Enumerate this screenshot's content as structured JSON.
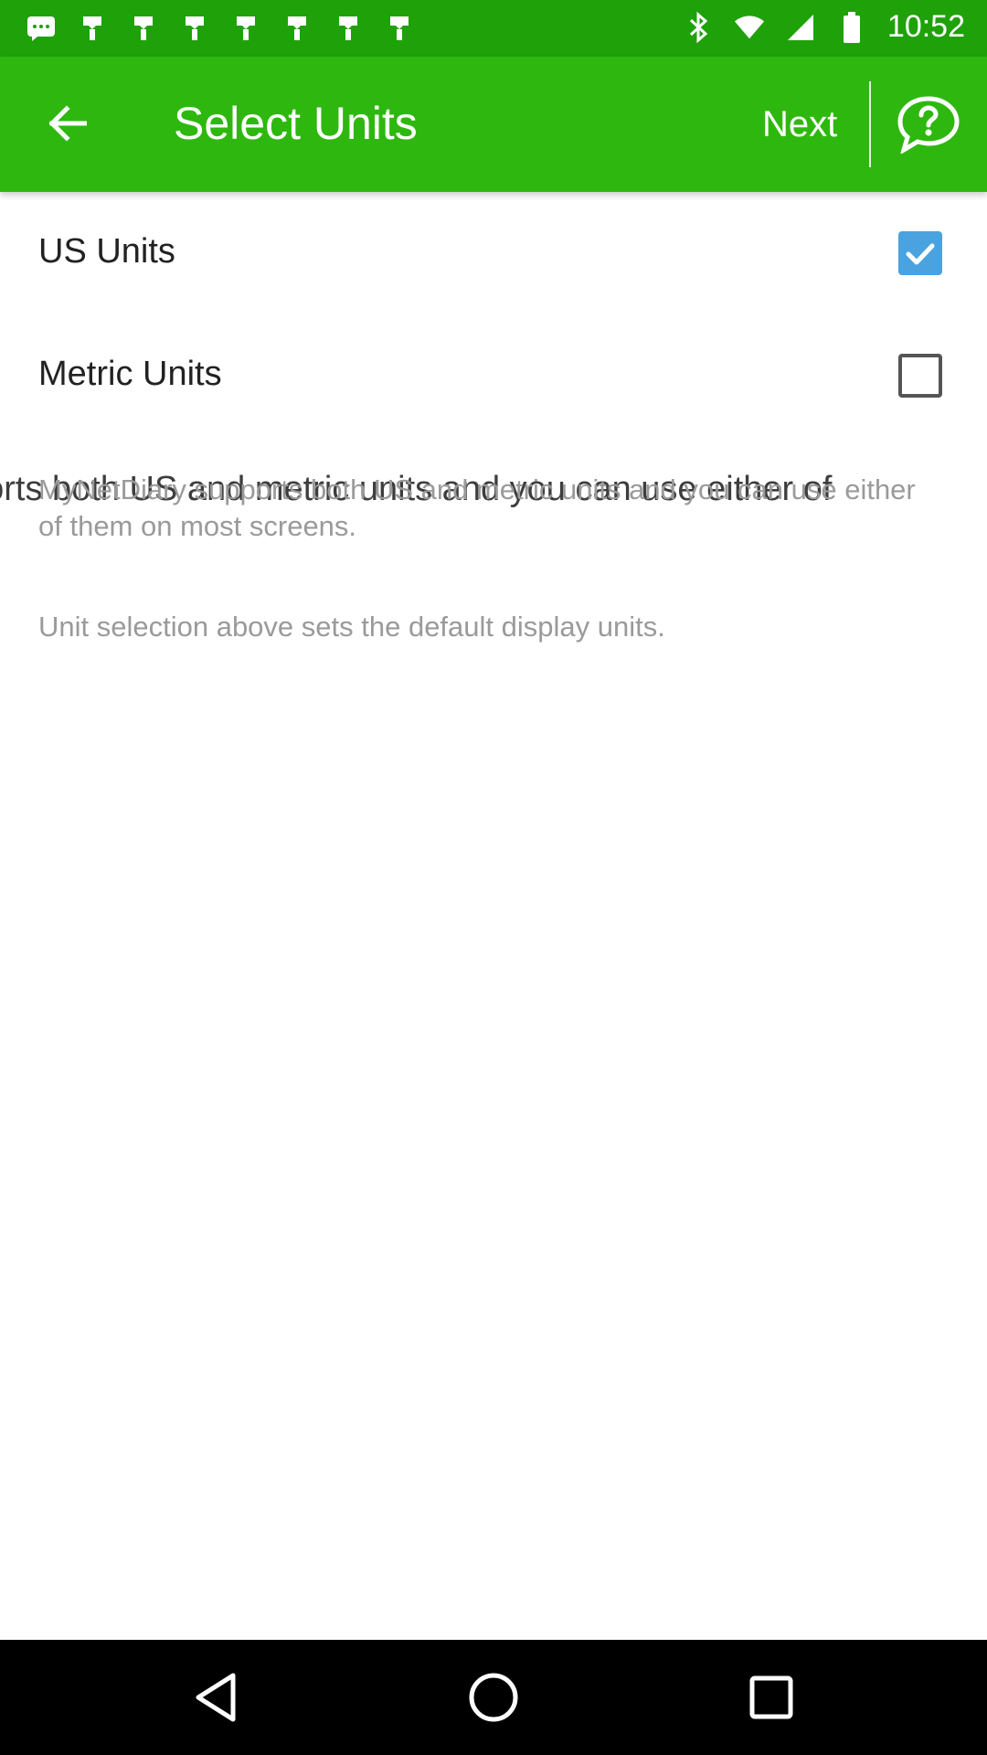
{
  "status_bar": {
    "time": "10:52",
    "icons": [
      "messaging-icon",
      "notification-icon",
      "bluetooth-icon",
      "wifi-icon",
      "signal-icon",
      "battery-icon"
    ]
  },
  "app_bar": {
    "title": "Select Units",
    "next_label": "Next",
    "back_icon": "arrow-back-icon",
    "help_icon": "help-chat-icon"
  },
  "options": [
    {
      "label": "US Units",
      "checked": true
    },
    {
      "label": "Metric Units",
      "checked": false
    }
  ],
  "info": {
    "overlay_text": "ports both US and metric units and you can use either of",
    "paragraph1": "MyNetDiary supports both US and metric units and you can use either of them on most screens.",
    "paragraph2": "Unit selection above sets the default display units."
  },
  "colors": {
    "status_bar": "#1fa10a",
    "app_bar": "#2eb80f",
    "checkbox_checked": "#4aa3df"
  },
  "nav_bar": {
    "buttons": [
      "back-triangle-icon",
      "home-circle-icon",
      "recents-square-icon"
    ]
  }
}
